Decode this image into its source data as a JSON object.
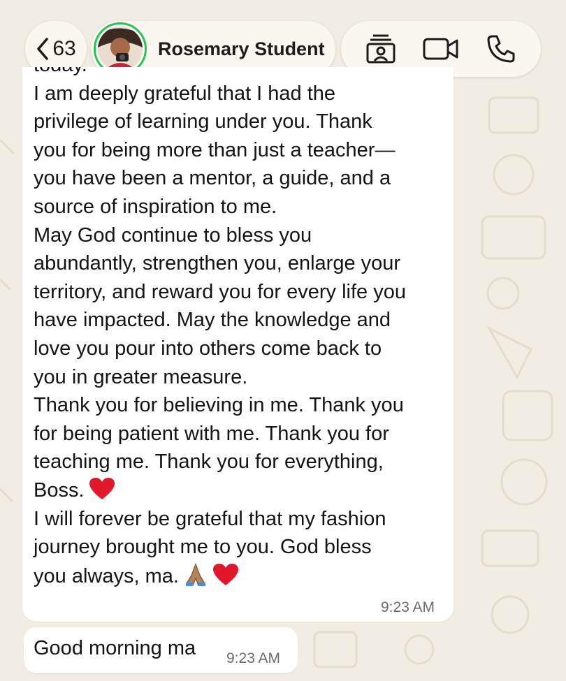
{
  "header": {
    "back_count": "63",
    "contact_name": "Rosemary Student"
  },
  "message_main": {
    "lines": [
      "today.",
      "I am deeply grateful that I had the",
      "privilege of learning under you. Thank",
      "you for being more than just a teacher—",
      "you have been a mentor, a guide, and a",
      "source of inspiration to me.",
      "May God continue to bless you",
      "abundantly, strengthen you, enlarge your",
      "territory, and reward you for every life you",
      "have impacted. May the knowledge and",
      "love you pour into others come back to",
      "you in greater measure.",
      "Thank you for believing in me. Thank you",
      "for being patient with me. Thank you for",
      "teaching me. Thank you for everything,",
      "Boss.",
      "I will forever be grateful that my fashion",
      "journey brought me to you. God bless",
      "you always, ma."
    ],
    "time": "9:23 AM"
  },
  "message_small": {
    "text": "Good morning ma",
    "time": "9:23 AM"
  },
  "colors": {
    "status_ring": "#25c453",
    "heart": "#e0182a"
  }
}
